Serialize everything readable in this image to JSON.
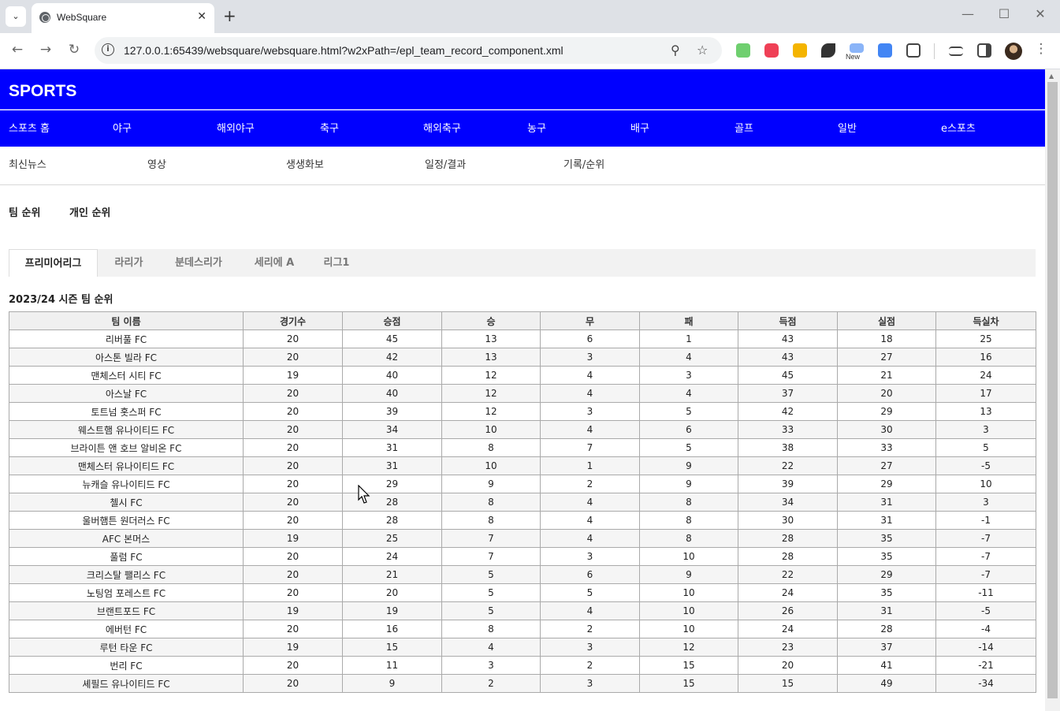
{
  "browser": {
    "tab_title": "WebSquare",
    "url": "127.0.0.1:65439/websquare/websquare.html?w2xPath=/epl_team_record_component.xml",
    "extension_new_badge": "New"
  },
  "site": {
    "brand": "SPORTS",
    "menu": [
      "스포츠 홈",
      "야구",
      "해외야구",
      "축구",
      "해외축구",
      "농구",
      "배구",
      "골프",
      "일반",
      "e스포츠"
    ],
    "submenu": [
      "최신뉴스",
      "영상",
      "생생화보",
      "일정/결과",
      "기록/순위"
    ],
    "rank_tabs": [
      "팀 순위",
      "개인 순위"
    ]
  },
  "leagues": {
    "tabs": [
      "프리미어리그",
      "라리가",
      "분데스리가",
      "세리에 A",
      "리그1"
    ],
    "active": "프리미어리그"
  },
  "standings": {
    "title": "2023/24 시즌 팀 순위",
    "columns": [
      "팀 이름",
      "경기수",
      "승점",
      "승",
      "무",
      "패",
      "득점",
      "실점",
      "득실차"
    ],
    "rows": [
      [
        "리버풀 FC",
        "20",
        "45",
        "13",
        "6",
        "1",
        "43",
        "18",
        "25"
      ],
      [
        "아스톤 빌라 FC",
        "20",
        "42",
        "13",
        "3",
        "4",
        "43",
        "27",
        "16"
      ],
      [
        "맨체스터 시티 FC",
        "19",
        "40",
        "12",
        "4",
        "3",
        "45",
        "21",
        "24"
      ],
      [
        "아스날 FC",
        "20",
        "40",
        "12",
        "4",
        "4",
        "37",
        "20",
        "17"
      ],
      [
        "토트넘 홋스퍼 FC",
        "20",
        "39",
        "12",
        "3",
        "5",
        "42",
        "29",
        "13"
      ],
      [
        "웨스트햄 유나이티드 FC",
        "20",
        "34",
        "10",
        "4",
        "6",
        "33",
        "30",
        "3"
      ],
      [
        "브라이튼 앤 호브 알비온 FC",
        "20",
        "31",
        "8",
        "7",
        "5",
        "38",
        "33",
        "5"
      ],
      [
        "맨체스터 유나이티드 FC",
        "20",
        "31",
        "10",
        "1",
        "9",
        "22",
        "27",
        "-5"
      ],
      [
        "뉴캐슬 유나이티드 FC",
        "20",
        "29",
        "9",
        "2",
        "9",
        "39",
        "29",
        "10"
      ],
      [
        "첼시 FC",
        "20",
        "28",
        "8",
        "4",
        "8",
        "34",
        "31",
        "3"
      ],
      [
        "울버햄튼 원더러스 FC",
        "20",
        "28",
        "8",
        "4",
        "8",
        "30",
        "31",
        "-1"
      ],
      [
        "AFC 본머스",
        "19",
        "25",
        "7",
        "4",
        "8",
        "28",
        "35",
        "-7"
      ],
      [
        "풀럼 FC",
        "20",
        "24",
        "7",
        "3",
        "10",
        "28",
        "35",
        "-7"
      ],
      [
        "크리스탈 팰리스 FC",
        "20",
        "21",
        "5",
        "6",
        "9",
        "22",
        "29",
        "-7"
      ],
      [
        "노팅엄 포레스트 FC",
        "20",
        "20",
        "5",
        "5",
        "10",
        "24",
        "35",
        "-11"
      ],
      [
        "브랜트포드 FC",
        "19",
        "19",
        "5",
        "4",
        "10",
        "26",
        "31",
        "-5"
      ],
      [
        "에버턴 FC",
        "20",
        "16",
        "8",
        "2",
        "10",
        "24",
        "28",
        "-4"
      ],
      [
        "루턴 타운 FC",
        "19",
        "15",
        "4",
        "3",
        "12",
        "23",
        "37",
        "-14"
      ],
      [
        "번리 FC",
        "20",
        "11",
        "3",
        "2",
        "15",
        "20",
        "41",
        "-21"
      ],
      [
        "셰필드 유나이티드 FC",
        "20",
        "9",
        "2",
        "3",
        "15",
        "15",
        "49",
        "-34"
      ]
    ]
  },
  "colors": {
    "brand_blue": "#0000ff"
  }
}
